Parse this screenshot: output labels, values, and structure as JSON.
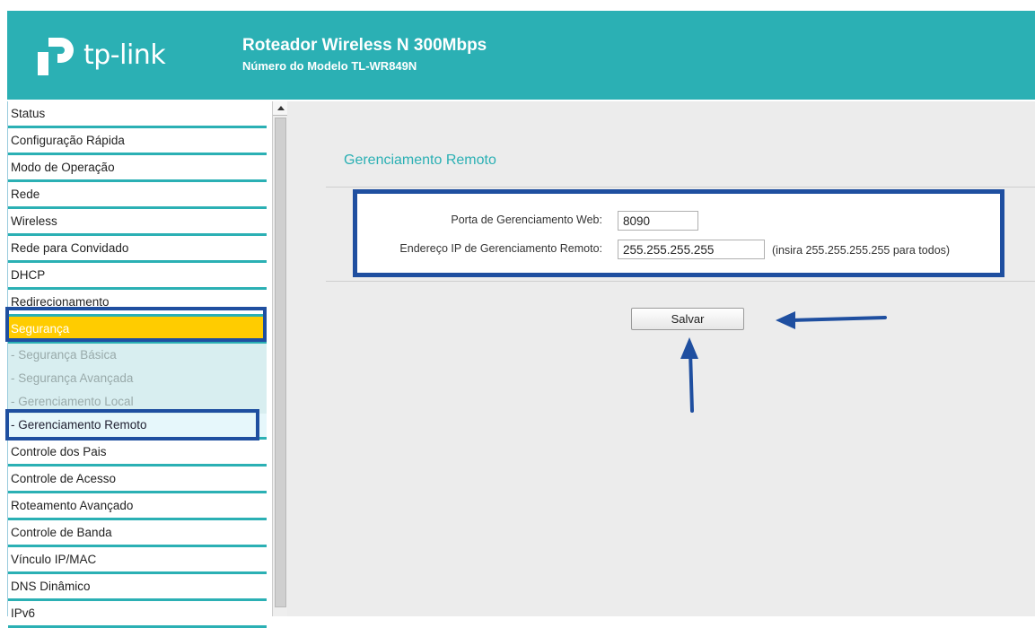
{
  "header": {
    "brand": "tp-link",
    "product_title": "Roteador Wireless N 300Mbps",
    "model_line": "Número do Modelo TL-WR849N",
    "bg_color": "#2bb0b4"
  },
  "sidebar": {
    "items": [
      {
        "label": "Status"
      },
      {
        "label": "Configuração Rápida"
      },
      {
        "label": "Modo de Operação"
      },
      {
        "label": "Rede"
      },
      {
        "label": "Wireless"
      },
      {
        "label": "Rede para Convidado"
      },
      {
        "label": "DHCP"
      },
      {
        "label": "Redirecionamento"
      },
      {
        "label": "Segurança"
      },
      {
        "label": "- Segurança Básica"
      },
      {
        "label": "- Segurança Avançada"
      },
      {
        "label": "- Gerenciamento Local"
      },
      {
        "label": "- Gerenciamento Remoto"
      },
      {
        "label": "Controle dos Pais"
      },
      {
        "label": "Controle de Acesso"
      },
      {
        "label": "Roteamento Avançado"
      },
      {
        "label": "Controle de Banda"
      },
      {
        "label": "Vínculo IP/MAC"
      },
      {
        "label": "DNS Dinâmico"
      },
      {
        "label": "IPv6"
      }
    ],
    "active_color": "#ffcc00"
  },
  "main": {
    "section_title": "Gerenciamento Remoto",
    "fields": {
      "port_label": "Porta de Gerenciamento Web:",
      "port_value": "8090",
      "ip_label": "Endereço IP de Gerenciamento Remoto:",
      "ip_value": "255.255.255.255",
      "ip_hint": "(insira 255.255.255.255 para todos)"
    },
    "save_label": "Salvar"
  },
  "annotation_color": "#1f4fa0"
}
